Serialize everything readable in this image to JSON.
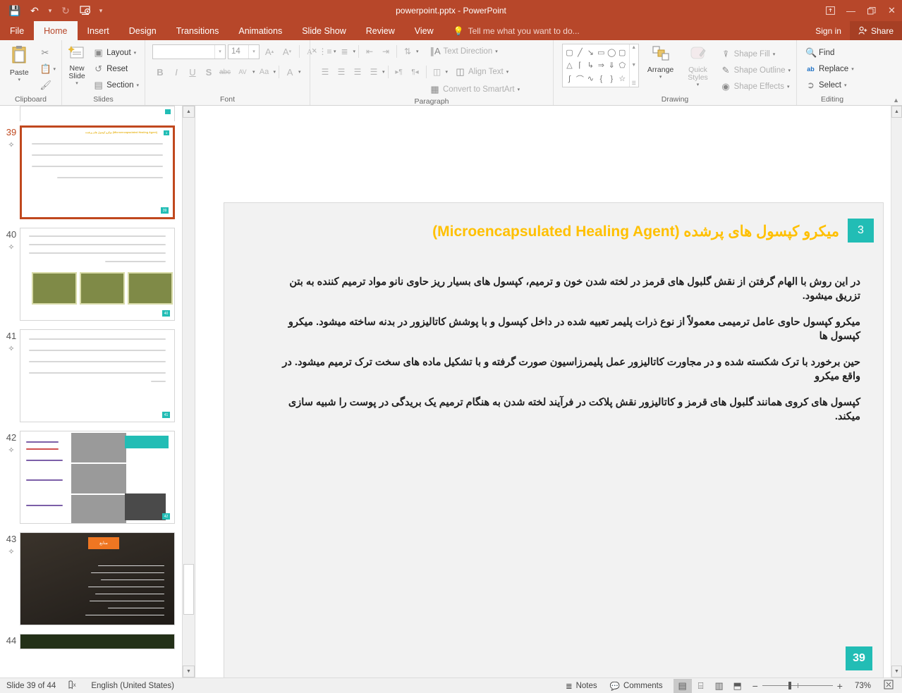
{
  "titlebar": {
    "document_title": "powerpoint.pptx - PowerPoint",
    "qat": [
      {
        "name": "save",
        "glyph": "💾"
      },
      {
        "name": "undo",
        "glyph": "↶"
      },
      {
        "name": "redo",
        "glyph": "↻"
      },
      {
        "name": "start-slideshow",
        "glyph": "⬛"
      },
      {
        "name": "customize-qat",
        "glyph": "▾"
      }
    ],
    "window_controls": {
      "ribbon_display": "⬜",
      "minimize": "—",
      "restore": "❐",
      "close": "✕"
    }
  },
  "tabs": [
    {
      "label": "File",
      "active": false
    },
    {
      "label": "Home",
      "active": true
    },
    {
      "label": "Insert",
      "active": false
    },
    {
      "label": "Design",
      "active": false
    },
    {
      "label": "Transitions",
      "active": false
    },
    {
      "label": "Animations",
      "active": false
    },
    {
      "label": "Slide Show",
      "active": false
    },
    {
      "label": "Review",
      "active": false
    },
    {
      "label": "View",
      "active": false
    }
  ],
  "tellme": {
    "label": "Tell me what you want to do...",
    "icon": "lightbulb-icon"
  },
  "account": {
    "signin_label": "Sign in",
    "share_label": "Share"
  },
  "ribbon": {
    "groups": [
      {
        "name": "clipboard",
        "label": "Clipboard",
        "paste_label": "Paste",
        "items": [
          {
            "label": "Cut",
            "icon": "scissors-icon"
          },
          {
            "label": "Copy",
            "icon": "copy-icon"
          },
          {
            "label": "Format Painter",
            "icon": "paintbrush-icon"
          }
        ]
      },
      {
        "name": "slides",
        "label": "Slides",
        "new_slide_label": "New Slide",
        "items": [
          {
            "label": "Layout",
            "icon": "layout-icon"
          },
          {
            "label": "Reset",
            "icon": "reset-icon"
          },
          {
            "label": "Section",
            "icon": "section-icon"
          }
        ]
      },
      {
        "name": "font",
        "label": "Font",
        "font_name_value": "",
        "font_size_value": "14",
        "buttons": [
          {
            "label": "Increase Font Size",
            "glyph": "A"
          },
          {
            "label": "Decrease Font Size",
            "glyph": "A"
          },
          {
            "label": "Clear All Formatting",
            "glyph": "✐"
          },
          {
            "label": "Bold",
            "glyph": "B"
          },
          {
            "label": "Italic",
            "glyph": "I"
          },
          {
            "label": "Underline",
            "glyph": "U"
          },
          {
            "label": "Text Shadow",
            "glyph": "S"
          },
          {
            "label": "Strikethrough",
            "glyph": "abc"
          },
          {
            "label": "Character Spacing",
            "glyph": "AV"
          },
          {
            "label": "Change Case",
            "glyph": "Aa"
          },
          {
            "label": "Font Color",
            "glyph": "A"
          }
        ]
      },
      {
        "name": "paragraph",
        "label": "Paragraph",
        "items": [
          {
            "label": "Text Direction",
            "icon": "text-direction-icon"
          },
          {
            "label": "Align Text",
            "icon": "align-text-icon"
          },
          {
            "label": "Convert to SmartArt",
            "icon": "smartart-icon"
          }
        ]
      },
      {
        "name": "drawing",
        "label": "Drawing",
        "arrange_label": "Arrange",
        "quick_styles_label": "Quick Styles",
        "shapes": [
          "▤",
          "╲",
          "↘",
          "▭",
          "◯",
          "▢",
          "△",
          "⌐",
          "⤷",
          "⇨",
          "⇩",
          "⌒",
          "∫",
          "⌢",
          "∿",
          "{",
          "}",
          "☆"
        ],
        "items": [
          {
            "label": "Shape Fill",
            "icon": "paint-bucket-icon"
          },
          {
            "label": "Shape Outline",
            "icon": "pencil-outline-icon"
          },
          {
            "label": "Shape Effects",
            "icon": "shape-effects-icon"
          }
        ]
      },
      {
        "name": "editing",
        "label": "Editing",
        "items": [
          {
            "label": "Find",
            "icon": "search-icon"
          },
          {
            "label": "Replace",
            "icon": "replace-icon"
          },
          {
            "label": "Select",
            "icon": "cursor-select-icon"
          }
        ]
      }
    ]
  },
  "thumbnails": [
    {
      "number": "39",
      "selected": true,
      "kind": "text",
      "title": "میکرو کپسول های پرشده (Microencapsulated Healing Agent)",
      "badge": "3",
      "slide_num": "39"
    },
    {
      "number": "40",
      "selected": false,
      "kind": "images-green",
      "title": "",
      "badge": "",
      "slide_num": "40"
    },
    {
      "number": "41",
      "selected": false,
      "kind": "text-only",
      "title": "",
      "badge": "",
      "slide_num": "41"
    },
    {
      "number": "42",
      "selected": false,
      "kind": "diagram",
      "title": "مکانیزم عملکرد میکرو کپسول ها در ترمیم ترک",
      "badge": "",
      "slide_num": "42"
    },
    {
      "number": "43",
      "selected": false,
      "kind": "dark-refs",
      "title": "منابع",
      "badge": "",
      "slide_num": "43"
    },
    {
      "number": "44",
      "selected": false,
      "kind": "partial",
      "title": "",
      "badge": "",
      "slide_num": "44"
    }
  ],
  "slide": {
    "title": "میکرو کپسول های پرشده (Microencapsulated Healing Agent)",
    "badge": "3",
    "number": "39",
    "title_color": "#ffc000",
    "badge_color": "#22bdb5",
    "paragraphs": [
      "در این روش با الهام گرفتن از نقش گلبول های قرمز در لخته شدن خون و ترمیم، کپسول های بسیار ریز حاوی نانو مواد ترمیم کننده به بتن تزریق میشود.",
      "میکرو کپسول حاوی عامل ترمیمی معمولاً از نوع ذرات پلیمر تعبیه شده در داخل کپسول و با پوشش کاتالیزور در بدنه ساخته میشود. میکرو کپسول ها",
      "حین برخورد با ترک شکسته شده و در مجاورت کاتالیزور عمل پلیمرزاسیون صورت گرفته و با تشکیل ماده های سخت ترک ترمیم میشود. در واقع میکرو",
      "کپسول های کروی همانند گلبول های قرمز و کاتالیزور نقش پلاکت در فرآیند لخته شدن به هنگام ترمیم یک بریدگی در پوست را شبیه سازی میکند."
    ]
  },
  "statusbar": {
    "slide_indicator": "Slide 39 of 44",
    "language": "English (United States)",
    "accessibility_icon": "spellcheck-icon",
    "notes_label": "Notes",
    "comments_label": "Comments",
    "views": [
      {
        "name": "normal-view",
        "glyph": "▤",
        "active": true
      },
      {
        "name": "slide-sorter-view",
        "glyph": "⌸",
        "active": false
      },
      {
        "name": "reading-view",
        "glyph": "▥",
        "active": false
      },
      {
        "name": "slideshow-view",
        "glyph": "⬒",
        "active": false
      }
    ],
    "zoom_out": "−",
    "zoom_in": "+",
    "zoom_level": "73%",
    "fit_to_window": "⛶"
  }
}
